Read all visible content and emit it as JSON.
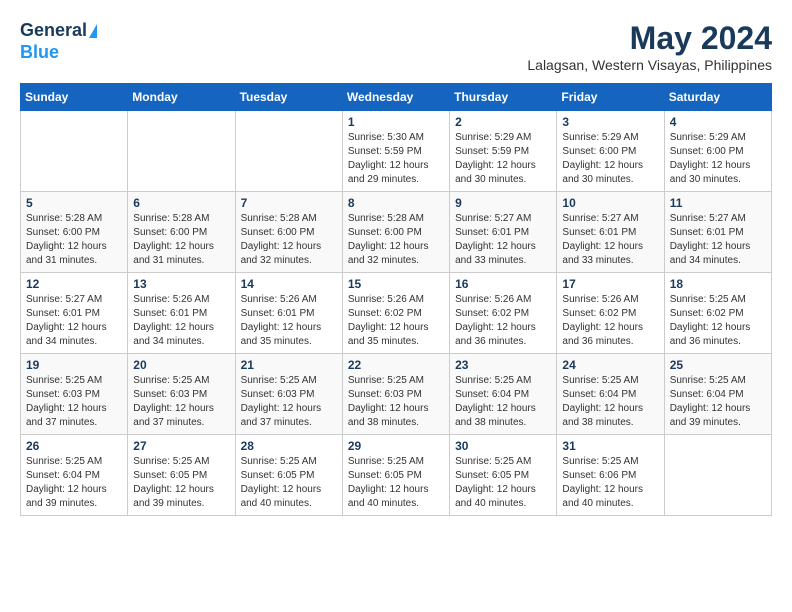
{
  "header": {
    "logo_line1": "General",
    "logo_line2": "Blue",
    "month_title": "May 2024",
    "location": "Lalagsan, Western Visayas, Philippines"
  },
  "days_of_week": [
    "Sunday",
    "Monday",
    "Tuesday",
    "Wednesday",
    "Thursday",
    "Friday",
    "Saturday"
  ],
  "weeks": [
    [
      {
        "day": "",
        "detail": ""
      },
      {
        "day": "",
        "detail": ""
      },
      {
        "day": "",
        "detail": ""
      },
      {
        "day": "1",
        "detail": "Sunrise: 5:30 AM\nSunset: 5:59 PM\nDaylight: 12 hours\nand 29 minutes."
      },
      {
        "day": "2",
        "detail": "Sunrise: 5:29 AM\nSunset: 5:59 PM\nDaylight: 12 hours\nand 30 minutes."
      },
      {
        "day": "3",
        "detail": "Sunrise: 5:29 AM\nSunset: 6:00 PM\nDaylight: 12 hours\nand 30 minutes."
      },
      {
        "day": "4",
        "detail": "Sunrise: 5:29 AM\nSunset: 6:00 PM\nDaylight: 12 hours\nand 30 minutes."
      }
    ],
    [
      {
        "day": "5",
        "detail": "Sunrise: 5:28 AM\nSunset: 6:00 PM\nDaylight: 12 hours\nand 31 minutes."
      },
      {
        "day": "6",
        "detail": "Sunrise: 5:28 AM\nSunset: 6:00 PM\nDaylight: 12 hours\nand 31 minutes."
      },
      {
        "day": "7",
        "detail": "Sunrise: 5:28 AM\nSunset: 6:00 PM\nDaylight: 12 hours\nand 32 minutes."
      },
      {
        "day": "8",
        "detail": "Sunrise: 5:28 AM\nSunset: 6:00 PM\nDaylight: 12 hours\nand 32 minutes."
      },
      {
        "day": "9",
        "detail": "Sunrise: 5:27 AM\nSunset: 6:01 PM\nDaylight: 12 hours\nand 33 minutes."
      },
      {
        "day": "10",
        "detail": "Sunrise: 5:27 AM\nSunset: 6:01 PM\nDaylight: 12 hours\nand 33 minutes."
      },
      {
        "day": "11",
        "detail": "Sunrise: 5:27 AM\nSunset: 6:01 PM\nDaylight: 12 hours\nand 34 minutes."
      }
    ],
    [
      {
        "day": "12",
        "detail": "Sunrise: 5:27 AM\nSunset: 6:01 PM\nDaylight: 12 hours\nand 34 minutes."
      },
      {
        "day": "13",
        "detail": "Sunrise: 5:26 AM\nSunset: 6:01 PM\nDaylight: 12 hours\nand 34 minutes."
      },
      {
        "day": "14",
        "detail": "Sunrise: 5:26 AM\nSunset: 6:01 PM\nDaylight: 12 hours\nand 35 minutes."
      },
      {
        "day": "15",
        "detail": "Sunrise: 5:26 AM\nSunset: 6:02 PM\nDaylight: 12 hours\nand 35 minutes."
      },
      {
        "day": "16",
        "detail": "Sunrise: 5:26 AM\nSunset: 6:02 PM\nDaylight: 12 hours\nand 36 minutes."
      },
      {
        "day": "17",
        "detail": "Sunrise: 5:26 AM\nSunset: 6:02 PM\nDaylight: 12 hours\nand 36 minutes."
      },
      {
        "day": "18",
        "detail": "Sunrise: 5:25 AM\nSunset: 6:02 PM\nDaylight: 12 hours\nand 36 minutes."
      }
    ],
    [
      {
        "day": "19",
        "detail": "Sunrise: 5:25 AM\nSunset: 6:03 PM\nDaylight: 12 hours\nand 37 minutes."
      },
      {
        "day": "20",
        "detail": "Sunrise: 5:25 AM\nSunset: 6:03 PM\nDaylight: 12 hours\nand 37 minutes."
      },
      {
        "day": "21",
        "detail": "Sunrise: 5:25 AM\nSunset: 6:03 PM\nDaylight: 12 hours\nand 37 minutes."
      },
      {
        "day": "22",
        "detail": "Sunrise: 5:25 AM\nSunset: 6:03 PM\nDaylight: 12 hours\nand 38 minutes."
      },
      {
        "day": "23",
        "detail": "Sunrise: 5:25 AM\nSunset: 6:04 PM\nDaylight: 12 hours\nand 38 minutes."
      },
      {
        "day": "24",
        "detail": "Sunrise: 5:25 AM\nSunset: 6:04 PM\nDaylight: 12 hours\nand 38 minutes."
      },
      {
        "day": "25",
        "detail": "Sunrise: 5:25 AM\nSunset: 6:04 PM\nDaylight: 12 hours\nand 39 minutes."
      }
    ],
    [
      {
        "day": "26",
        "detail": "Sunrise: 5:25 AM\nSunset: 6:04 PM\nDaylight: 12 hours\nand 39 minutes."
      },
      {
        "day": "27",
        "detail": "Sunrise: 5:25 AM\nSunset: 6:05 PM\nDaylight: 12 hours\nand 39 minutes."
      },
      {
        "day": "28",
        "detail": "Sunrise: 5:25 AM\nSunset: 6:05 PM\nDaylight: 12 hours\nand 40 minutes."
      },
      {
        "day": "29",
        "detail": "Sunrise: 5:25 AM\nSunset: 6:05 PM\nDaylight: 12 hours\nand 40 minutes."
      },
      {
        "day": "30",
        "detail": "Sunrise: 5:25 AM\nSunset: 6:05 PM\nDaylight: 12 hours\nand 40 minutes."
      },
      {
        "day": "31",
        "detail": "Sunrise: 5:25 AM\nSunset: 6:06 PM\nDaylight: 12 hours\nand 40 minutes."
      },
      {
        "day": "",
        "detail": ""
      }
    ]
  ]
}
